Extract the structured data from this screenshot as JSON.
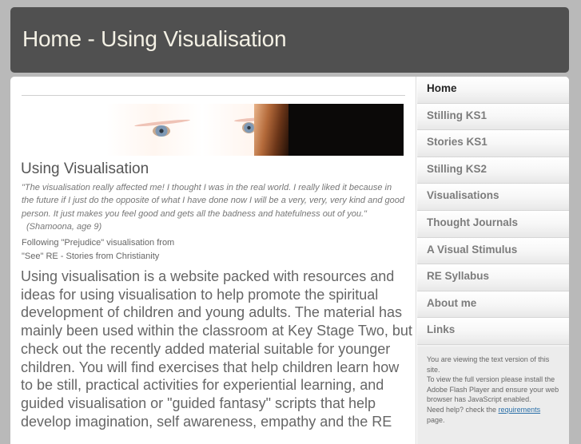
{
  "header": {
    "title": "Home - Using Visualisation"
  },
  "banner": {
    "icon": "eyes-banner-image",
    "description": "Close-up photo of a child's eyes and hair"
  },
  "main": {
    "section_title": "Using Visualisation",
    "quote": {
      "text": "\"The visualisation really affected me! I thought I was in the real world. I really liked it because in the future if I just do the opposite of what I have done now I will be a very, very, very kind and good person. It just makes you feel good and gets all the badness and hatefulness out of you.\"",
      "citation": "(Shamoona, age 9)"
    },
    "following": {
      "line1": "Following \"Prejudice\" visualisation from",
      "line2": "\"See\" RE - Stories from Christianity"
    },
    "intro": "Using visualisation is a website packed with resources and ideas for using visualisation to help promote the spiritual development of children and young adults. The material has mainly been used within the classroom at Key Stage Two, but check out the recently added material suitable for younger children. You will find exercises that help children learn how to be still, practical activities for experiential learning, and guided visualisation or \"guided fantasy\" scripts that help develop imagination, self awareness, empathy and the RE"
  },
  "sidebar": {
    "items": [
      {
        "label": "Home",
        "active": true
      },
      {
        "label": "Stilling KS1",
        "active": false
      },
      {
        "label": "Stories KS1",
        "active": false
      },
      {
        "label": "Stilling KS2",
        "active": false
      },
      {
        "label": "Visualisations",
        "active": false
      },
      {
        "label": "Thought Journals",
        "active": false
      },
      {
        "label": "A Visual Stimulus",
        "active": false
      },
      {
        "label": "RE Syllabus",
        "active": false
      },
      {
        "label": "About me",
        "active": false
      },
      {
        "label": "Links",
        "active": false
      }
    ],
    "notice": {
      "line1": "You are viewing the text version of this site.",
      "line2": "To view the full version please install the Adobe Flash Player and ensure your web browser has JavaScript enabled.",
      "help_prefix": "Need help? check the ",
      "link_label": "requirements",
      "help_suffix": " page."
    }
  },
  "colors": {
    "background": "#b9b9b9",
    "header": "#505050",
    "header_text": "#f3f0e4",
    "body_text": "#666666",
    "active_nav": "#262626",
    "inactive_nav": "#7c7c7c",
    "link": "#2a6fa8"
  }
}
